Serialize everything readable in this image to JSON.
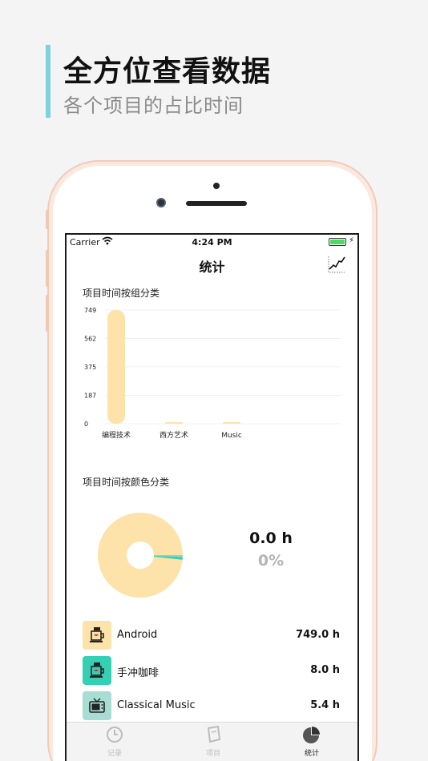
{
  "promo": {
    "title": "全方位查看数据",
    "subtitle": "各个项目的占比时间"
  },
  "status_bar": {
    "carrier": "Carrier",
    "time": "4:24 PM",
    "battery_icon": "battery-charging-icon"
  },
  "nav": {
    "title": "统计",
    "right_icon": "trend-chart-icon"
  },
  "bar_section": {
    "title": "项目时间按组分类"
  },
  "pie_section": {
    "title": "项目时间按颜色分类",
    "value": "0.0 h",
    "percent": "0%"
  },
  "chart_data": [
    {
      "type": "bar",
      "categories": [
        "编程技术",
        "西方艺术",
        "Music"
      ],
      "values": [
        749,
        8,
        5.4
      ],
      "yticks": [
        "749",
        "562",
        "375",
        "187",
        "0"
      ],
      "ylim": [
        0,
        749
      ],
      "grid": true,
      "color": "#fde3aa"
    },
    {
      "type": "pie",
      "donut": true,
      "slices": [
        {
          "value": 749.0,
          "color": "#fde3aa"
        },
        {
          "value": 8.0,
          "color": "#35d0b4"
        },
        {
          "value": 5.4,
          "color": "#8fd0c6"
        }
      ]
    }
  ],
  "items": [
    {
      "name": "Android",
      "hours": "749.0 h",
      "color": "#fde3aa",
      "icon": "coffee-cup-icon"
    },
    {
      "name": "手冲咖啡",
      "hours": "8.0 h",
      "color": "#35d0b4",
      "icon": "coffee-cup-icon"
    },
    {
      "name": "Classical Music",
      "hours": "5.4 h",
      "color": "#a7ddd3",
      "icon": "tv-icon"
    }
  ],
  "tabs": [
    {
      "label": "记录",
      "icon": "clock-icon"
    },
    {
      "label": "项目",
      "icon": "book-icon"
    },
    {
      "label": "统计",
      "icon": "pie-chart-icon",
      "active": true
    }
  ]
}
